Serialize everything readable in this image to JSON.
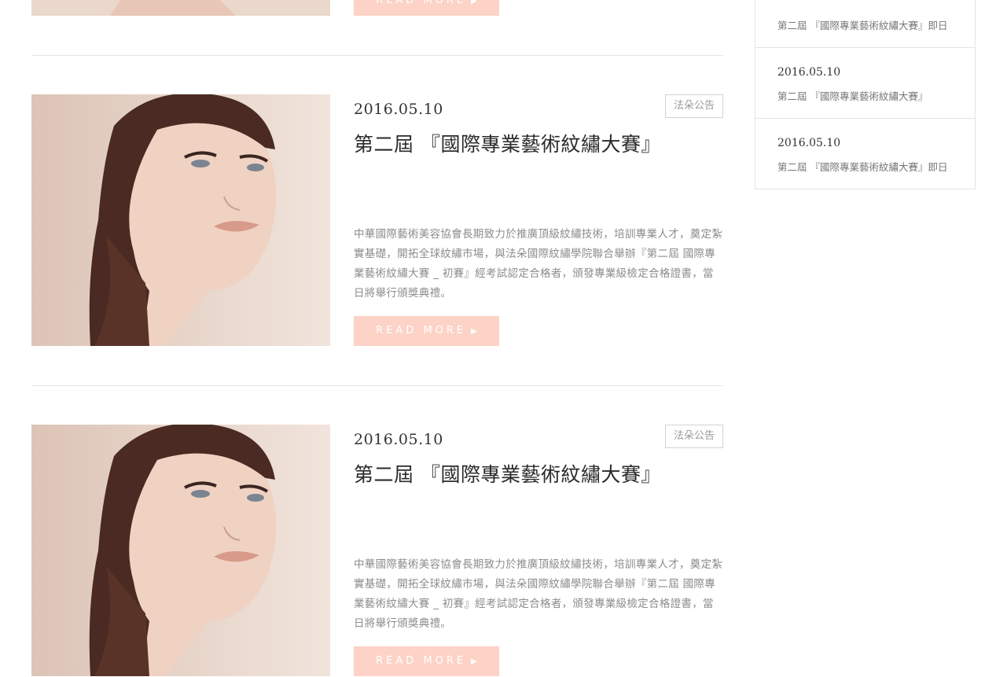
{
  "top_partial": {
    "read_more_label": "READ MORE"
  },
  "posts": [
    {
      "date": "2016.05.10",
      "title": "第二屆 『國際專業藝術紋繡大賽』",
      "category": "法朵公告",
      "excerpt": "中華國際藝術美容協會長期致力於推廣頂級紋繡技術，培訓專業人才，奠定紮實基礎，開拓全球紋繡市場，與法朵國際紋繡學院聯合舉辦『第二屆 國際專業藝術紋繡大賽 _ 初賽』經考試認定合格者，頒發專業級檢定合格證書，當日將舉行頒獎典禮。",
      "read_more_label": "READ MORE"
    },
    {
      "date": "2016.05.10",
      "title": "第二屆 『國際專業藝術紋繡大賽』",
      "category": "法朵公告",
      "excerpt": "中華國際藝術美容協會長期致力於推廣頂級紋繡技術，培訓專業人才，奠定紮實基礎，開拓全球紋繡市場，與法朵國際紋繡學院聯合舉辦『第二屆 國際專業藝術紋繡大賽 _ 初賽』經考試認定合格者，頒發專業級檢定合格證書，當日將舉行頒獎典禮。",
      "read_more_label": "READ MORE"
    }
  ],
  "sidebar": {
    "items": [
      {
        "date": "",
        "title": "第二屆 『國際專業藝術紋繡大賽』即日"
      },
      {
        "date": "2016.05.10",
        "title": "第二屆 『國際專業藝術紋繡大賽』"
      },
      {
        "date": "2016.05.10",
        "title": "第二屆 『國際專業藝術紋繡大賽』即日"
      }
    ]
  },
  "colors": {
    "button_bg": "#fcd3c6",
    "button_text": "#ffffff",
    "divider": "#e6e6e6",
    "excerpt_text": "#8c8c8c"
  },
  "icons": {
    "read_more_arrow": "play-arrow-icon"
  }
}
